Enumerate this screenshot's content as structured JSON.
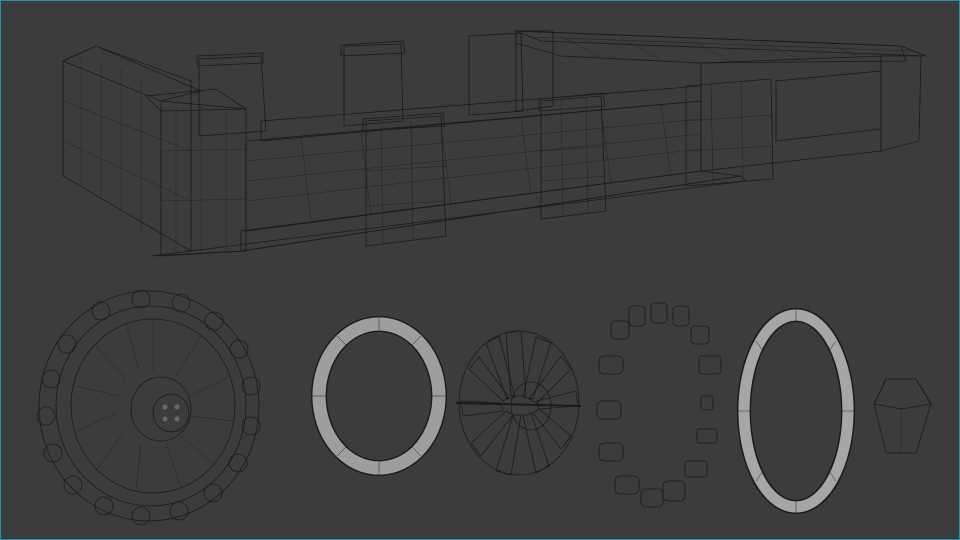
{
  "scene": {
    "background": "#3c3c3c",
    "border_color": "#2a8fb0",
    "model_shade": "#9a9a9a",
    "model_light": "#b5b5b5",
    "model_dark": "#6e6e6e",
    "wire_color": "#1a1a1a"
  },
  "objects": {
    "hull": "tank-hull-wireframe",
    "assembled_wheel": "sprocket-wheel-assembled",
    "outer_ring": "wheel-outer-ring",
    "spoked_hub": "spoked-hub",
    "teeth_ring": "sprocket-teeth-ring",
    "rim_ring": "wheel-rim-ring",
    "hex_cap": "hex-nut-cap"
  }
}
